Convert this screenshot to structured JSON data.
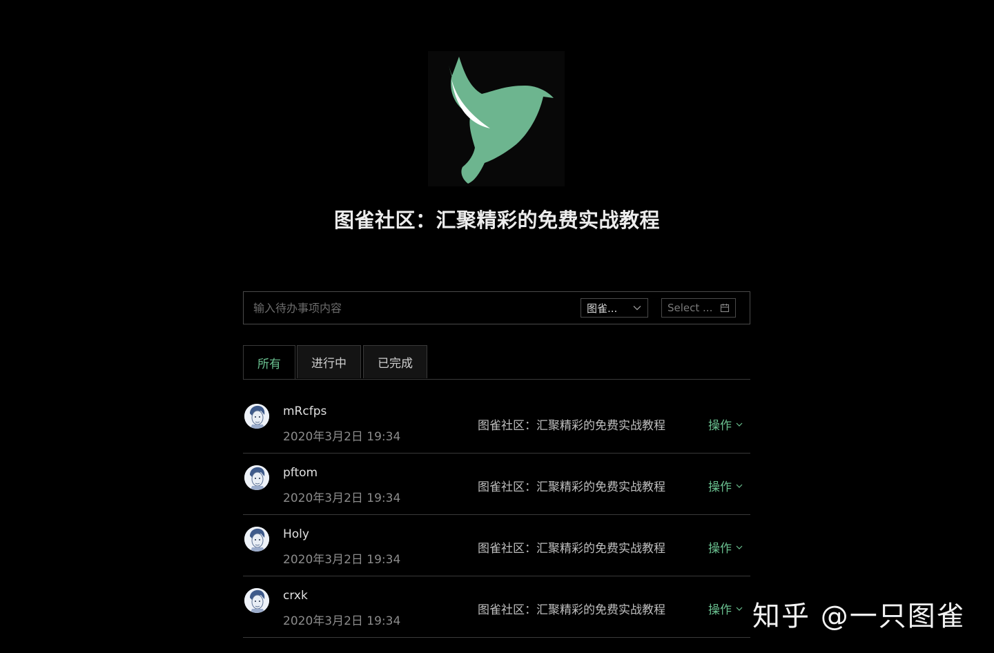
{
  "header": {
    "logo_icon": "hummingbird-logo",
    "title": "图雀社区：汇聚精彩的免费实战教程"
  },
  "todo_form": {
    "input_placeholder": "输入待办事项内容",
    "input_value": "",
    "category_select": "图雀...",
    "date_select": "Select ..."
  },
  "tabs": [
    {
      "label": "所有",
      "active": true
    },
    {
      "label": "进行中",
      "active": false
    },
    {
      "label": "已完成",
      "active": false
    }
  ],
  "todos": [
    {
      "user": "mRcfps",
      "date": "2020年3月2日 19:34",
      "content": "图雀社区：汇聚精彩的免费实战教程",
      "action": "操作"
    },
    {
      "user": "pftom",
      "date": "2020年3月2日 19:34",
      "content": "图雀社区：汇聚精彩的免费实战教程",
      "action": "操作"
    },
    {
      "user": "Holy",
      "date": "2020年3月2日 19:34",
      "content": "图雀社区：汇聚精彩的免费实战教程",
      "action": "操作"
    },
    {
      "user": "crxk",
      "date": "2020年3月2日 19:34",
      "content": "图雀社区：汇聚精彩的免费实战教程",
      "action": "操作"
    }
  ],
  "watermark": "知乎 @一只图雀",
  "colors": {
    "background": "#000000",
    "accent": "#6ac190",
    "logo_green": "#6db58f",
    "border": "#3a3a3a"
  }
}
